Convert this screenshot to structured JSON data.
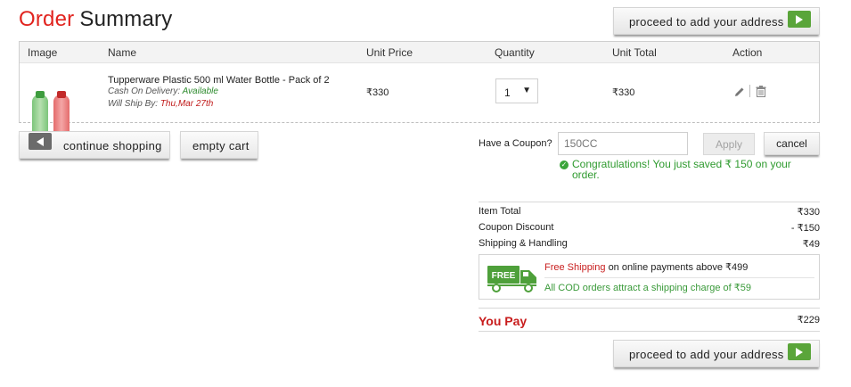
{
  "title": {
    "part1": "Order",
    "part2": "Summary"
  },
  "proceed_button": {
    "label": "proceed to add your address"
  },
  "table": {
    "headers": [
      "Image",
      "Name",
      "Unit Price",
      "Quantity",
      "Unit Total",
      "Action"
    ],
    "item": {
      "name": "Tupperware Plastic 500 ml Water Bottle - Pack of 2",
      "cod_label": "Cash On Delivery:",
      "cod_value": "Available",
      "ship_label": "Will Ship By:",
      "ship_value": "Thu,Mar 27th",
      "unit_price": "₹330",
      "quantity": "1",
      "unit_total": "₹330"
    }
  },
  "cart_buttons": {
    "continue": "continue shopping",
    "empty": "empty cart"
  },
  "coupon": {
    "label": "Have a Coupon?",
    "value": "150CC",
    "apply": "Apply",
    "cancel": "cancel",
    "success": "Congratulations! You just saved ₹ 150 on your order."
  },
  "summary": {
    "item_total_label": "Item Total",
    "item_total": "₹330",
    "discount_label": "Coupon Discount",
    "discount": "- ₹150",
    "shipping_label": "Shipping & Handling",
    "shipping": "₹49"
  },
  "shipping_info": {
    "truck_badge": "FREE",
    "free_shipping": "Free Shipping",
    "free_rest": "on online payments above ₹499",
    "cod_note": "All COD orders attract a shipping charge of ₹59"
  },
  "you_pay": {
    "label": "You Pay",
    "value": "₹229"
  },
  "colors": {
    "accent_red": "#e1241f",
    "green": "#5aa53a"
  }
}
